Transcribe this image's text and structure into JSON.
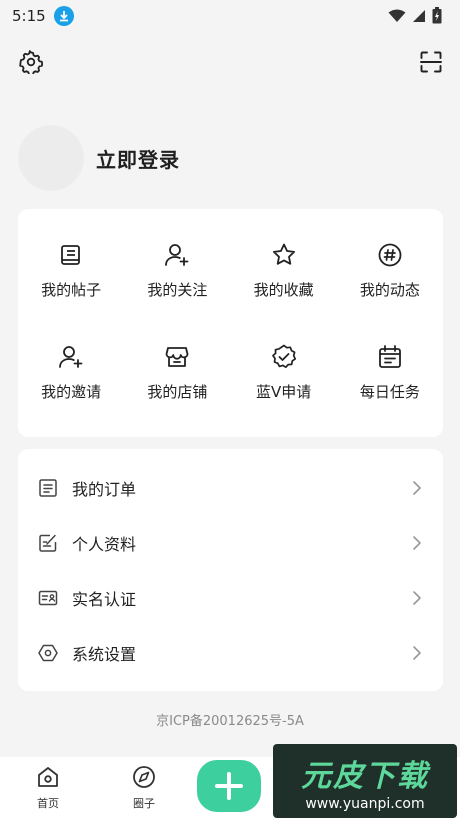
{
  "status_bar": {
    "time": "5:15"
  },
  "profile": {
    "login_label": "立即登录"
  },
  "grid": {
    "items": [
      {
        "label": "我的帖子",
        "icon": "post-icon"
      },
      {
        "label": "我的关注",
        "icon": "user-plus-icon"
      },
      {
        "label": "我的收藏",
        "icon": "star-icon"
      },
      {
        "label": "我的动态",
        "icon": "hash-icon"
      },
      {
        "label": "我的邀请",
        "icon": "invite-icon"
      },
      {
        "label": "我的店铺",
        "icon": "store-icon"
      },
      {
        "label": "蓝V申请",
        "icon": "verified-badge-icon"
      },
      {
        "label": "每日任务",
        "icon": "calendar-icon"
      }
    ]
  },
  "menu": {
    "items": [
      {
        "label": "我的订单",
        "icon": "order-icon"
      },
      {
        "label": "个人资料",
        "icon": "edit-profile-icon"
      },
      {
        "label": "实名认证",
        "icon": "id-card-icon"
      },
      {
        "label": "系统设置",
        "icon": "hexagon-settings-icon"
      }
    ]
  },
  "footer": {
    "icp": "京ICP备20012625号-5A"
  },
  "tabs": {
    "home": "首页",
    "circle": "圈子"
  },
  "watermark": {
    "title": "元皮下载",
    "url": "www.yuanpi.com"
  },
  "colors": {
    "accent": "#3ecf9e",
    "download_badge": "#1aa0e8"
  }
}
